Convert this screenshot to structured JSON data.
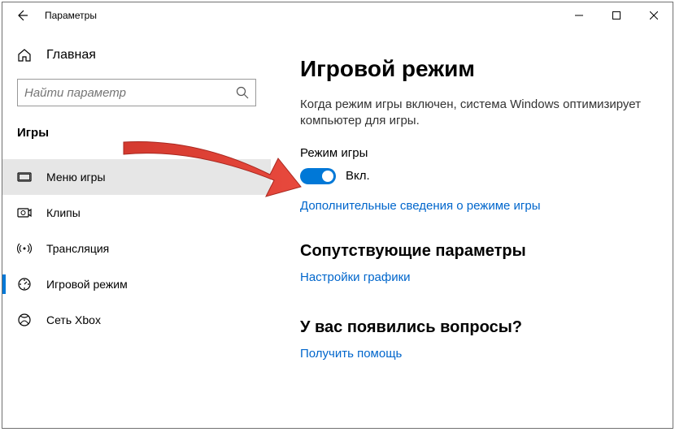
{
  "titlebar": {
    "title": "Параметры"
  },
  "sidebar": {
    "home_label": "Главная",
    "search_placeholder": "Найти параметр",
    "section_header": "Игры",
    "items": [
      {
        "label": "Меню игры"
      },
      {
        "label": "Клипы"
      },
      {
        "label": "Трансляция"
      },
      {
        "label": "Игровой режим"
      },
      {
        "label": "Сеть Xbox"
      }
    ]
  },
  "main": {
    "heading": "Игровой режим",
    "description": "Когда режим игры включен, система Windows оптимизирует компьютер для игры.",
    "toggle_label": "Режим игры",
    "toggle_state": "Вкл.",
    "more_info_link": "Дополнительные сведения о режиме игры",
    "related_heading": "Сопутствующие параметры",
    "graphics_link": "Настройки графики",
    "help_heading": "У вас появились вопросы?",
    "help_link": "Получить помощь"
  }
}
